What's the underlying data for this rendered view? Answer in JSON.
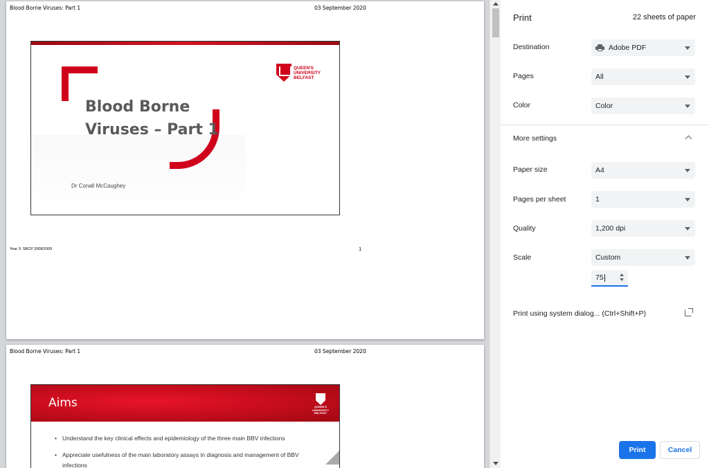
{
  "preview": {
    "page1": {
      "header_left": "Blood Borne Viruses: Part 1",
      "header_right": "03 September 2020",
      "slide_title_line1": "Blood Borne",
      "slide_title_line2": "Viruses – Part 1",
      "slide_author": "Dr Conall McCaughey",
      "logo_line1": "QUEEN'S",
      "logo_line2": "UNIVERSITY",
      "logo_line3": "BELFAST",
      "footer_left": "Year 3: SBCP 2008/2009",
      "footer_right": "1"
    },
    "page2": {
      "header_left": "Blood Borne Viruses: Part 1",
      "header_right": "03 September 2020",
      "slide_title": "Aims",
      "logo_text": "QUEEN'S UNIVERSITY BELFAST",
      "bullets": [
        "Understand the key clinical effects and epidemiology of the three main BBV infections",
        "Appreciate usefulness of the main laboratory assays in diagnosis and management of BBV infections"
      ]
    }
  },
  "sidebar": {
    "title": "Print",
    "sheets": "22 sheets of paper",
    "destination": {
      "label": "Destination",
      "value": "Adobe PDF",
      "icon": "printer-icon"
    },
    "pages": {
      "label": "Pages",
      "value": "All"
    },
    "color": {
      "label": "Color",
      "value": "Color"
    },
    "more_settings": "More settings",
    "paper_size": {
      "label": "Paper size",
      "value": "A4"
    },
    "pages_per_sheet": {
      "label": "Pages per sheet",
      "value": "1"
    },
    "quality": {
      "label": "Quality",
      "value": "1,200 dpi"
    },
    "scale": {
      "label": "Scale",
      "value": "Custom",
      "custom_value": "75"
    },
    "system_dialog": "Print using system dialog... (Ctrl+Shift+P)",
    "print_button": "Print",
    "cancel_button": "Cancel"
  },
  "colors": {
    "accent": "#1a73e8",
    "brand_red": "#d0021b",
    "preview_bg": "#d4d6d9"
  }
}
